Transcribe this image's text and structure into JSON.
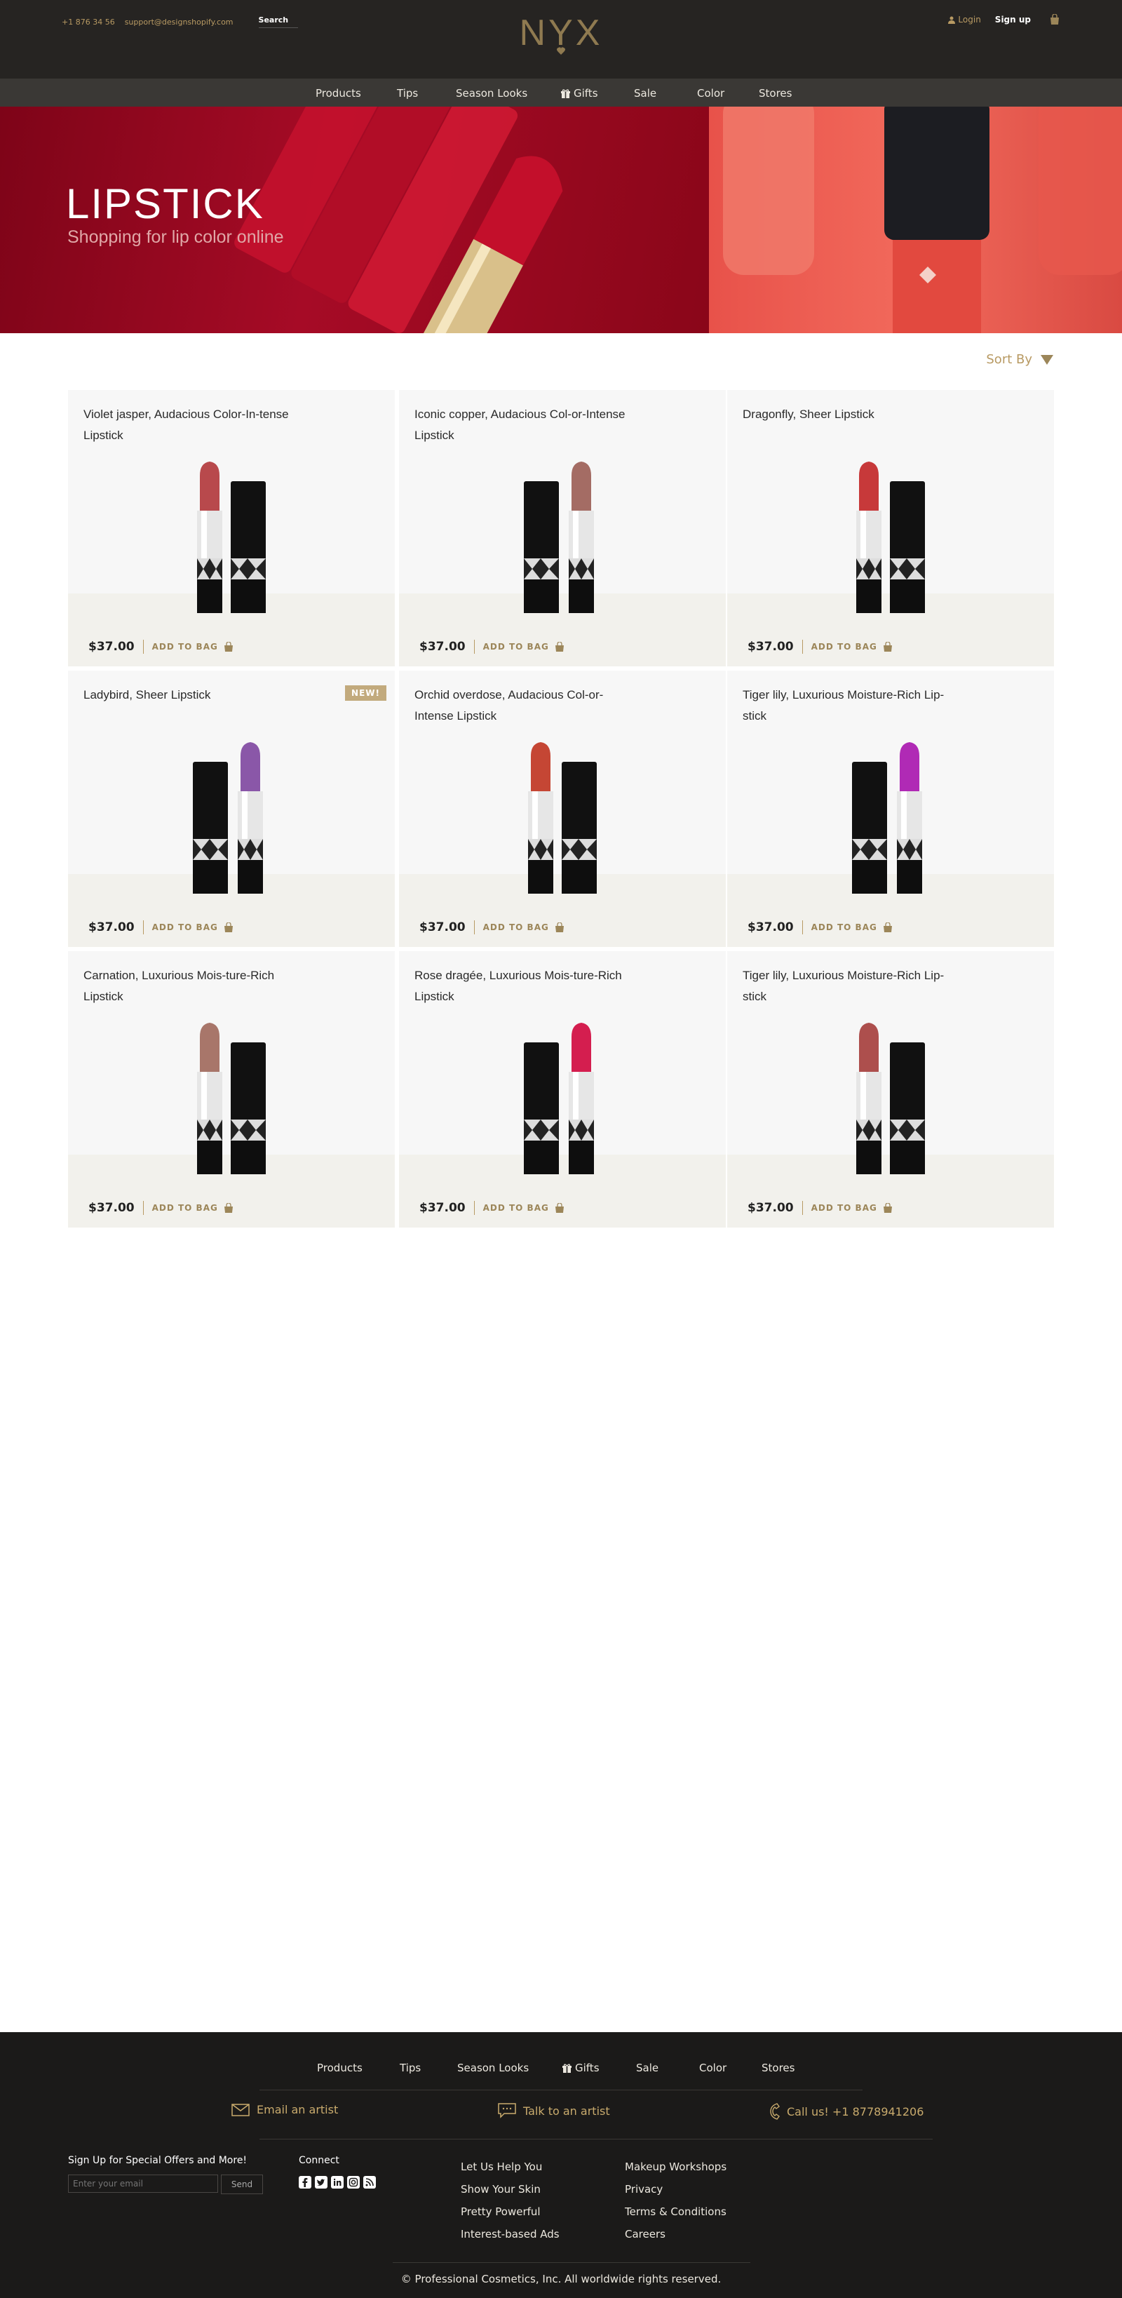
{
  "topbar": {
    "phone": "+1 876 34 56",
    "email": "support@designshopify.com",
    "search_label": "Search",
    "logo_text": "NYX",
    "login_label": "Login",
    "signup_label": "Sign up",
    "accent_color": "#b89a63"
  },
  "nav": {
    "items": [
      "Products",
      "Tips",
      "Season Looks",
      "Gifts",
      "Sale",
      "Color",
      "Stores"
    ]
  },
  "hero": {
    "title": "LIPSTICK",
    "subtitle": "Shopping for lip color online"
  },
  "sort": {
    "label": "Sort By"
  },
  "products": [
    {
      "name": "Violet jasper, Audacious Color-In-tense Lipstick",
      "price": "$37.00",
      "add_label": "ADD TO BAG",
      "badge": "",
      "shade": "#b8494c"
    },
    {
      "name": "Iconic copper, Audacious Col-or-Intense Lipstick",
      "price": "$37.00",
      "add_label": "ADD TO BAG",
      "badge": "",
      "shade": "#a46c64"
    },
    {
      "name": "Dragonfly, Sheer Lipstick",
      "price": "$37.00",
      "add_label": "ADD TO BAG",
      "badge": "",
      "shade": "#c7393a"
    },
    {
      "name": "Ladybird, Sheer Lipstick",
      "price": "$37.00",
      "add_label": "ADD TO BAG",
      "badge": "NEW!",
      "shade": "#8a57a8"
    },
    {
      "name": "Orchid overdose, Audacious Col-or-Intense Lipstick",
      "price": "$37.00",
      "add_label": "ADD TO BAG",
      "badge": "",
      "shade": "#c54634"
    },
    {
      "name": "Tiger lily, Luxurious Moisture-Rich Lip-stick",
      "price": "$37.00",
      "add_label": "ADD TO BAG",
      "badge": "",
      "shade": "#b02ab5"
    },
    {
      "name": "Carnation, Luxurious Mois-ture-Rich Lipstick",
      "price": "$37.00",
      "add_label": "ADD TO BAG",
      "badge": "",
      "shade": "#a8766a"
    },
    {
      "name": "Rose dragée, Luxurious Mois-ture-Rich Lipstick",
      "price": "$37.00",
      "add_label": "ADD TO BAG",
      "badge": "",
      "shade": "#d41e4f"
    },
    {
      "name": "Tiger lily, Luxurious Moisture-Rich Lip-stick",
      "price": "$37.00",
      "add_label": "ADD TO BAG",
      "badge": "",
      "shade": "#ad4f4d"
    }
  ],
  "footer": {
    "nav": [
      "Products",
      "Tips",
      "Season Looks",
      "Gifts",
      "Sale",
      "Color",
      "Stores"
    ],
    "email_artist": "Email an artist",
    "talk_artist": "Talk to an artist",
    "call_us": "Call us! +1 8778941206",
    "signup_title": "Sign Up for Special Offers and More!",
    "email_placeholder": "Enter your email",
    "send_label": "Send",
    "connect_title": "Connect",
    "social_icons": [
      "facebook-icon",
      "twitter-icon",
      "linkedin-icon",
      "instagram-icon",
      "rss-icon"
    ],
    "links_col1": [
      "Let Us Help You",
      "Show Your Skin",
      "Pretty Powerful",
      "Interest-based Ads"
    ],
    "links_col2": [
      "Makeup Workshops",
      "Privacy",
      "Terms & Conditions",
      "Careers"
    ],
    "copyright": "© Professional Cosmetics, Inc. All worldwide rights reserved."
  }
}
